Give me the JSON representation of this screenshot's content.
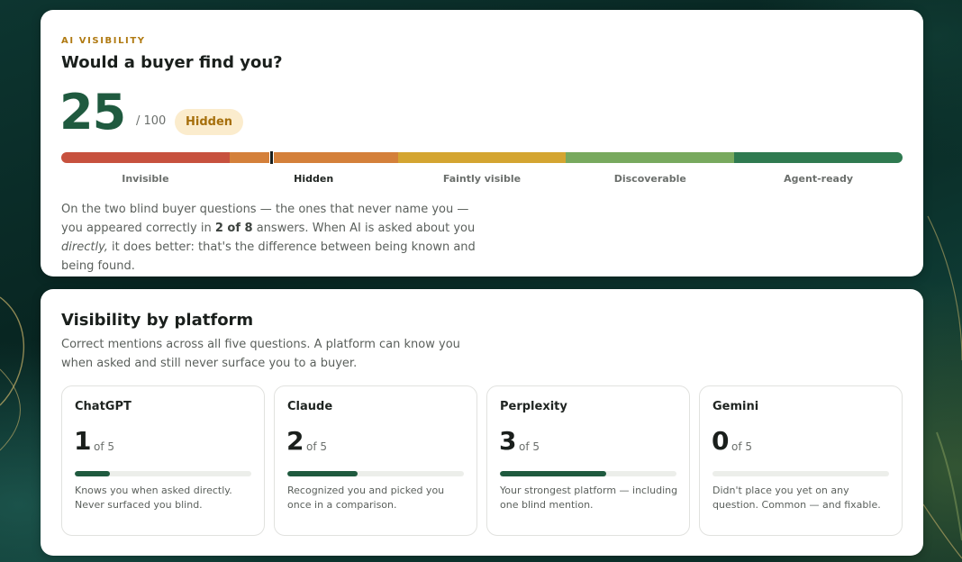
{
  "visibility": {
    "eyebrow": "AI VISIBILITY",
    "title": "Would a buyer find you?",
    "score": "25",
    "score_max": "/ 100",
    "status": "Hidden",
    "scale_labels": [
      "Invisible",
      "Hidden",
      "Faintly visible",
      "Discoverable",
      "Agent-ready"
    ],
    "marker_fraction": 0.25,
    "summary": {
      "part1": "On the two blind buyer questions — the ones that never name you — you appeared correctly in ",
      "bold": "2 of 8",
      "part2": " answers. When AI is asked about you ",
      "italic": "directly,",
      "part3": " it does better: that's the difference between being known and being found."
    }
  },
  "platforms": {
    "title": "Visibility by platform",
    "subtitle": "Correct mentions across all five questions. A platform can know you when asked and still never surface you to a buyer.",
    "items": [
      {
        "name": "ChatGPT",
        "count": "1",
        "of": "of 5",
        "fraction": 0.2,
        "note": "Knows you when asked directly. Never surfaced you blind."
      },
      {
        "name": "Claude",
        "count": "2",
        "of": "of 5",
        "fraction": 0.4,
        "note": "Recognized you and picked you once in a comparison."
      },
      {
        "name": "Perplexity",
        "count": "3",
        "of": "of 5",
        "fraction": 0.6,
        "note": "Your strongest platform — including one blind mention."
      },
      {
        "name": "Gemini",
        "count": "0",
        "of": "of 5",
        "fraction": 0.0,
        "note": "Didn't place you yet on any question. Common — and fixable."
      }
    ]
  },
  "colors": {
    "accent": "#1f5a3f",
    "status_badge_bg": "#fbeccd",
    "status_badge_text": "#a66f0c",
    "scale": [
      "#c7513e",
      "#d4803a",
      "#d4a531",
      "#78a95e",
      "#2f7a50"
    ]
  }
}
